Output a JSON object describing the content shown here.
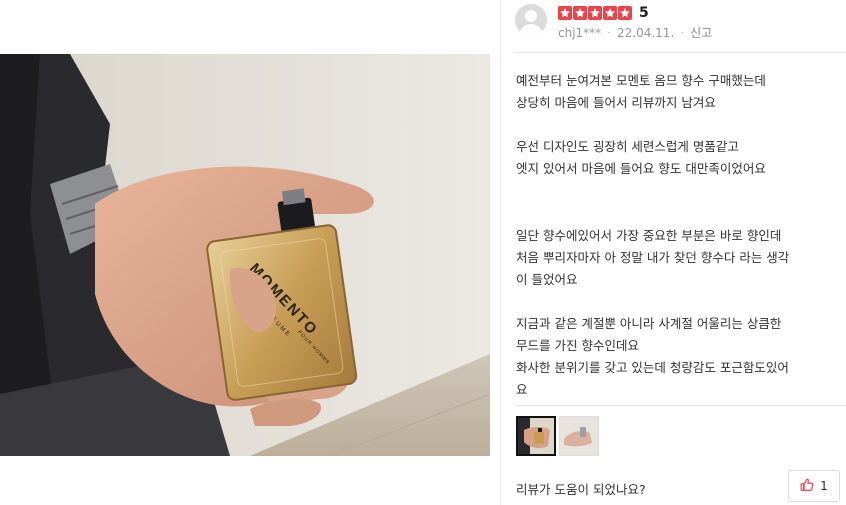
{
  "review": {
    "rating_value": 5,
    "score_label": "5",
    "author": "chj1***",
    "date": "22.04.11.",
    "report_label": "신고",
    "text": "예전부터 눈여겨본 모멘토 옴므 향수 구매했는데\n상당히 마음에 들어서 리뷰까지 남겨요\n\n우선 디자인도 굉장히 세련스럽게 명품같고\n엣지 있어서 마음에 들어요 향도 대만족이었어요\n\n\n일단 향수에있어서 가장 중요한 부분은 바로 향인데\n처음 뿌리자마자 아 정말 내가 찾던 향수다 라는 생각\n이 들었어요\n\n지금과 같은 계절뿐 아니라  사계절 어울리는 상큼한\n무드를 가진 향수인데요\n화사한 분위기를 갖고 있는데 청량감도 포근함도있어\n요",
    "helpful_question": "리뷰가 도움이 되었나요?",
    "like_count": "1"
  },
  "photo": {
    "bottle_brand": "MOMENTO",
    "bottle_sub": "PERFUME",
    "bottle_line": "POUR HOMME"
  },
  "colors": {
    "star": "#f0414a",
    "text": "#333333",
    "meta": "#999999"
  },
  "icons": {
    "avatar": "default-user-avatar",
    "like": "thumbs-up-icon",
    "star": "star-icon"
  }
}
